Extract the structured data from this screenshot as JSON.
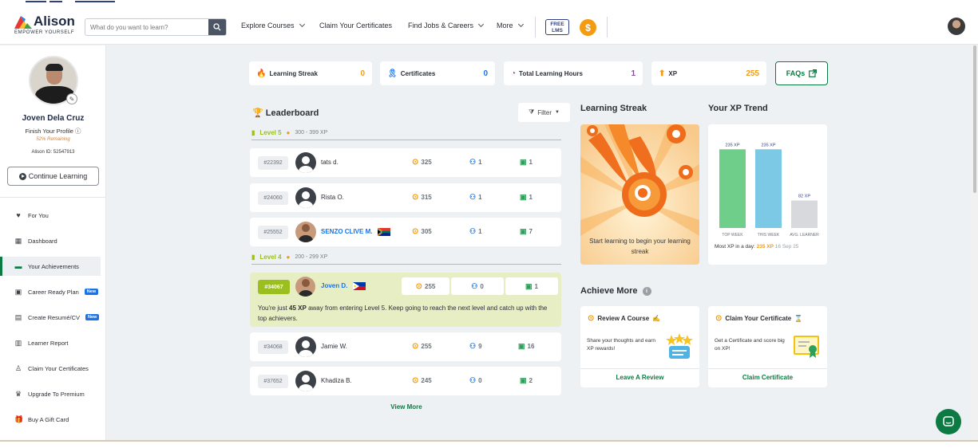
{
  "brand": {
    "name": "Alison",
    "tagline": "EMPOWER YOURSELF"
  },
  "search": {
    "placeholder": "What do you want to learn?"
  },
  "nav": {
    "explore": "Explore Courses",
    "claim": "Claim Your Certificates",
    "jobs": "Find Jobs & Careers",
    "more": "More",
    "free_lms_1": "FREE",
    "free_lms_2": "LMS",
    "coin_symbol": "$"
  },
  "profile": {
    "name": "Joven Dela Cruz",
    "finish": "Finish Your Profile",
    "remaining": "52% Remaining",
    "id": "Alison ID: 52547913",
    "continue": "Continue Learning"
  },
  "sidebar": {
    "items": [
      {
        "label": "For You"
      },
      {
        "label": "Dashboard"
      },
      {
        "label": "Your Achievements"
      },
      {
        "label": "Career Ready Plan",
        "badge": "New"
      },
      {
        "label": "Create Resumé/CV",
        "badge": "New"
      },
      {
        "label": "Learner Report"
      },
      {
        "label": "Claim Your Certificates"
      },
      {
        "label": "Upgrade To Premium"
      },
      {
        "label": "Buy A Gift Card"
      }
    ]
  },
  "stats": {
    "streak": {
      "label": "Learning Streak",
      "value": "0"
    },
    "certificates": {
      "label": "Certificates",
      "value": "0"
    },
    "hours": {
      "label": "Total Learning Hours",
      "value": "1"
    },
    "xp": {
      "label": "XP",
      "value": "255"
    },
    "faqs": "FAQs"
  },
  "leaderboard": {
    "title": "Leaderboard",
    "filter": "Filter",
    "level5": {
      "label": "Level 5",
      "range": "300 - 399 XP"
    },
    "level4": {
      "label": "Level 4",
      "range": "200 - 299 XP"
    },
    "rows": [
      {
        "rank": "#22392",
        "name": "tats d.",
        "xp": "325",
        "certs": "1",
        "courses": "1"
      },
      {
        "rank": "#24060",
        "name": "Rista O.",
        "xp": "315",
        "certs": "1",
        "courses": "1"
      },
      {
        "rank": "#25552",
        "name": "SENZO CLIVE M.",
        "xp": "305",
        "certs": "1",
        "courses": "7"
      },
      {
        "rank": "#34068",
        "name": "Jamie W.",
        "xp": "255",
        "certs": "9",
        "courses": "16"
      },
      {
        "rank": "#37652",
        "name": "Khadiza B.",
        "xp": "245",
        "certs": "0",
        "courses": "2"
      }
    ],
    "you": {
      "rank": "#34067",
      "name": "Joven D.",
      "xp": "255",
      "certs": "0",
      "courses": "1",
      "msg_a": "You're just ",
      "msg_xp": "45 XP",
      "msg_b": " away from entering Level 5. Keep going to reach the next level and catch up with the top achievers."
    },
    "view_more": "View More"
  },
  "streak_card": {
    "title": "Learning Streak",
    "text": "Start learning to begin your learning streak"
  },
  "xp_trend": {
    "title": "Your XP Trend",
    "most_label": "Most XP in a day:",
    "most_value": "235 XP",
    "most_date": "16 Sep 25",
    "colors": [
      "#6fcf8a",
      "#7cc9e6",
      "#d7d9dc"
    ]
  },
  "chart_data": {
    "type": "bar",
    "categories": [
      "TOP WEEK",
      "THIS WEEK",
      "AVG. LEARNER"
    ],
    "values": [
      235,
      235,
      82
    ],
    "data_labels": [
      "235 XP",
      "235 XP",
      "82 XP"
    ],
    "title": "Your XP Trend",
    "ylim": [
      0,
      250
    ]
  },
  "achieve": {
    "title": "Achieve More",
    "review": {
      "title": "Review A Course",
      "desc": "Share your thoughts and earn XP rewards!",
      "link": "Leave A Review"
    },
    "certificate": {
      "title": "Claim Your Certificate",
      "desc": "Get a Certificate and score big on XP!",
      "link": "Claim Certificate"
    }
  }
}
